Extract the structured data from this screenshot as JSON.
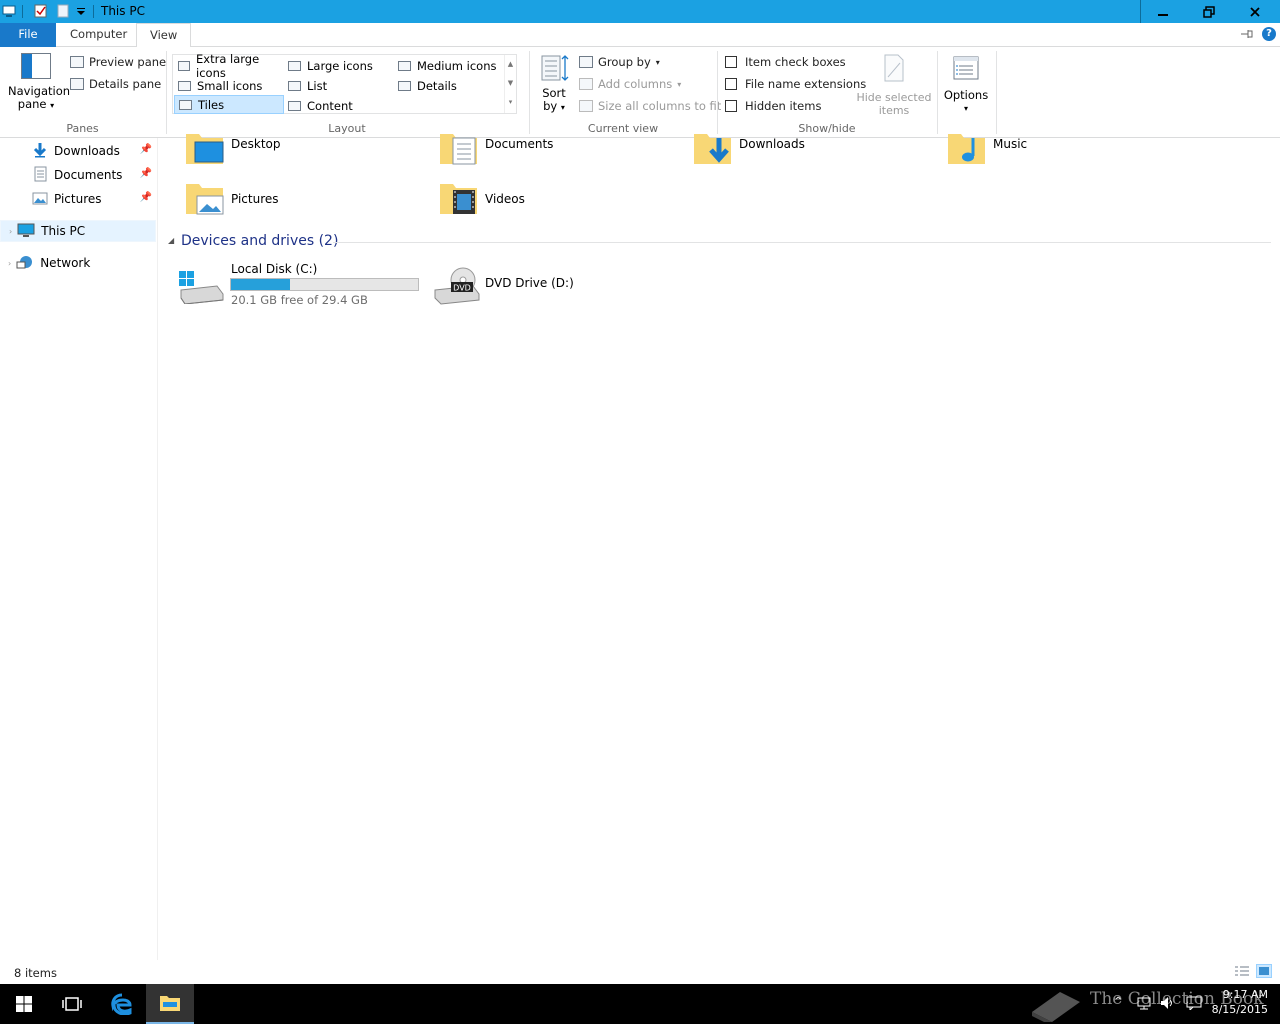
{
  "window": {
    "title": "This PC"
  },
  "tabs": {
    "file": "File",
    "computer": "Computer",
    "view": "View"
  },
  "ribbon": {
    "panes": {
      "label": "Panes",
      "navigation_pane": "Navigation\npane",
      "navigation_pane_l1": "Navigation",
      "navigation_pane_l2": "pane",
      "preview_pane": "Preview pane",
      "details_pane": "Details pane"
    },
    "layout": {
      "label": "Layout",
      "options": [
        "Extra large icons",
        "Large icons",
        "Medium icons",
        "Small icons",
        "List",
        "Details",
        "Tiles",
        "Content"
      ],
      "selected": "Tiles"
    },
    "current_view": {
      "label": "Current view",
      "sort_by_l1": "Sort",
      "sort_by_l2": "by",
      "group_by": "Group by",
      "add_columns": "Add columns",
      "size_columns": "Size all columns to fit"
    },
    "show_hide": {
      "label": "Show/hide",
      "item_check_boxes": "Item check boxes",
      "file_name_extensions": "File name extensions",
      "hidden_items": "Hidden items",
      "hide_selected_l1": "Hide selected",
      "hide_selected_l2": "items"
    },
    "options": {
      "label": "Options"
    }
  },
  "nav": {
    "items": [
      {
        "label": "Downloads",
        "pinned": true
      },
      {
        "label": "Documents",
        "pinned": true
      },
      {
        "label": "Pictures",
        "pinned": true
      },
      {
        "label": "This PC",
        "selected": true
      },
      {
        "label": "Network"
      }
    ]
  },
  "content": {
    "folders": [
      "Desktop",
      "Documents",
      "Downloads",
      "Music",
      "Pictures",
      "Videos"
    ],
    "devices_header": "Devices and drives (2)",
    "drives": [
      {
        "name": "Local Disk (C:)",
        "free_text": "20.1 GB free of 29.4 GB",
        "used_fraction": 0.316
      },
      {
        "name": "DVD Drive (D:)",
        "badge": "DVD"
      }
    ]
  },
  "status": {
    "items": "8 items"
  },
  "taskbar": {
    "time": "9:17 AM",
    "date": "8/15/2015",
    "watermark": "The Collection Book"
  },
  "colors": {
    "titlebar": "#1ba1e2",
    "file_tab": "#1979ca",
    "accent": "#1e7a96",
    "selection": "#cce8ff"
  }
}
